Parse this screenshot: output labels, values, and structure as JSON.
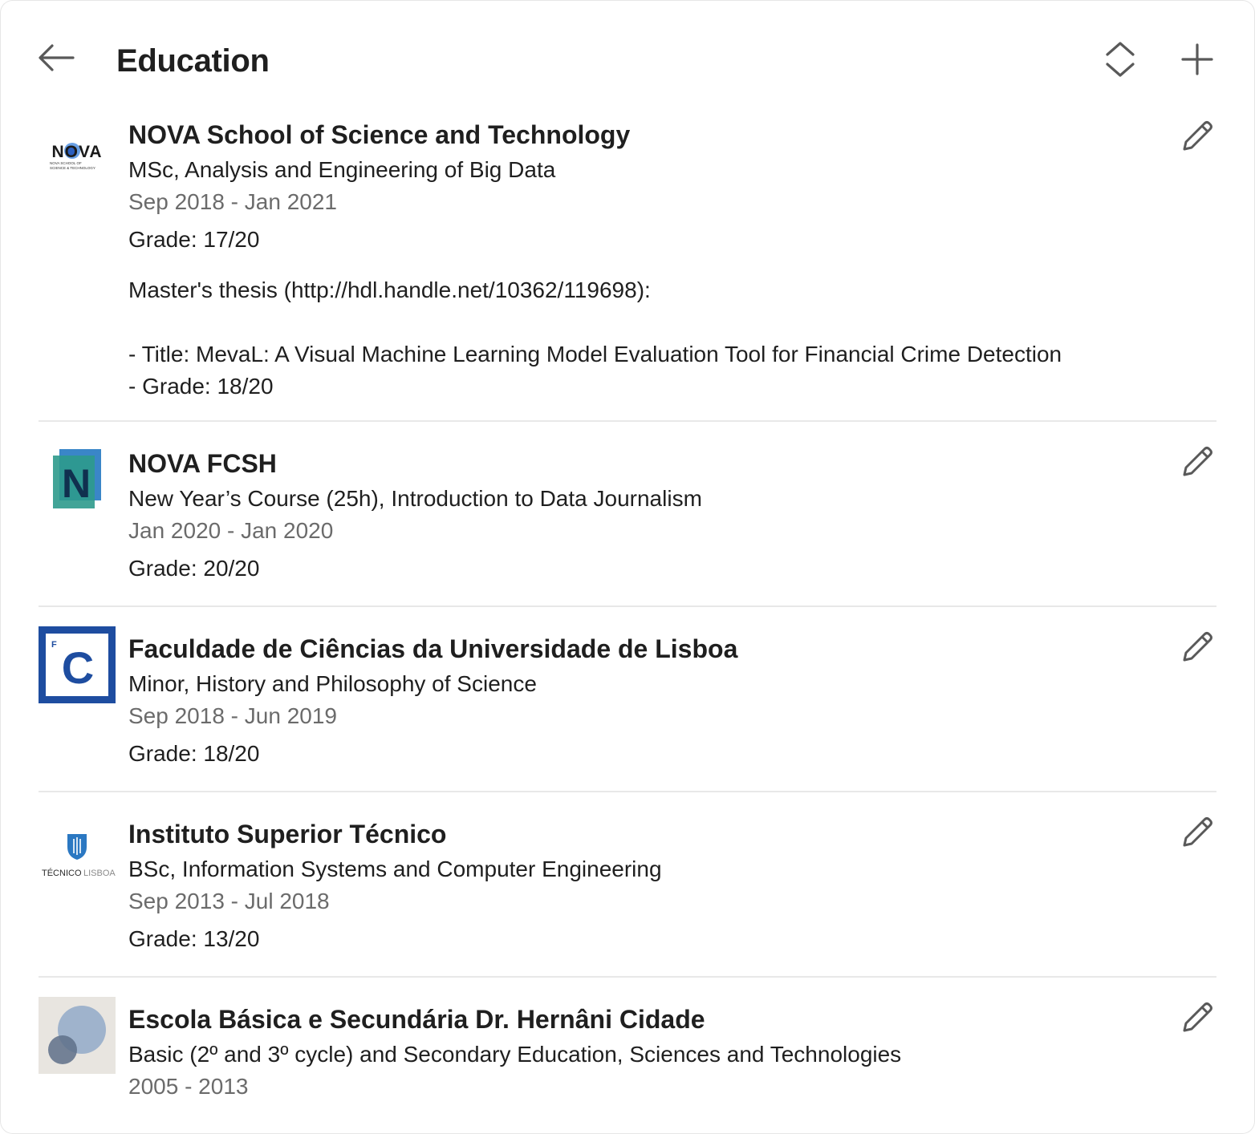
{
  "header": {
    "title": "Education",
    "back_icon": "arrow-left-icon",
    "reorder_icon": "reorder-icon",
    "add_icon": "plus-icon"
  },
  "colors": {
    "text": "#1f1f1f",
    "muted": "#6b6b6b",
    "divider": "#e8e8e8",
    "icon": "#595959"
  },
  "items": [
    {
      "school": "NOVA School of Science and Technology",
      "degree": "MSc, Analysis and Engineering of Big Data",
      "dates": "Sep 2018 - Jan 2021",
      "grade": "Grade: 17/20",
      "description": "Master's thesis (http://hdl.handle.net/10362/119698):\n\n- Title: MevaL: A Visual Machine Learning Model Evaluation Tool for Financial Crime Detection\n- Grade: 18/20",
      "logo": {
        "type": "nova-sst",
        "text_main": "NOVA",
        "text_sub1": "NOVA SCHOOL OF",
        "text_sub2": "SCIENCE & TECHNOLOGY"
      }
    },
    {
      "school": "NOVA FCSH",
      "degree": "New Year’s Course (25h), Introduction to Data Journalism",
      "dates": "Jan 2020 - Jan 2020",
      "grade": "Grade: 20/20",
      "logo": {
        "type": "nova-fcsh",
        "text_main": "N"
      }
    },
    {
      "school": "Faculdade de Ciências da Universidade de Lisboa",
      "degree": "Minor, History and Philosophy of Science",
      "dates": "Sep 2018 - Jun 2019",
      "grade": "Grade: 18/20",
      "logo": {
        "type": "fcul",
        "text_main": "C",
        "text_small": "F"
      }
    },
    {
      "school": "Instituto Superior Técnico",
      "degree": "BSc, Information Systems and Computer Engineering",
      "dates": "Sep 2013 - Jul 2018",
      "grade": "Grade: 13/20",
      "logo": {
        "type": "ist",
        "text_a": "TÉCNICO",
        "text_b": "LISBOA"
      }
    },
    {
      "school": "Escola Básica e Secundária Dr. Hernâni Cidade",
      "degree": "Basic (2º and 3º cycle) and Secondary Education, Sciences and Technologies",
      "dates": "2005 - 2013",
      "logo": {
        "type": "placeholder"
      }
    }
  ]
}
